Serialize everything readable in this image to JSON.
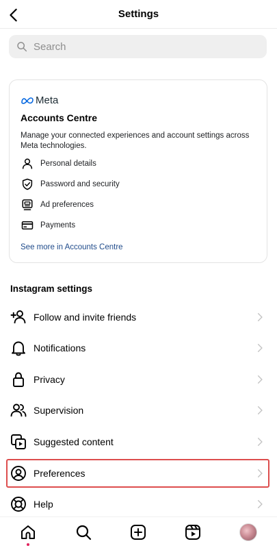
{
  "header": {
    "title": "Settings",
    "back_icon": "chevron-left-icon"
  },
  "search": {
    "placeholder": "Search",
    "value": ""
  },
  "accounts_centre": {
    "brand": "Meta",
    "title": "Accounts Centre",
    "description": "Manage your connected experiences and account settings across Meta technologies.",
    "items": [
      {
        "label": "Personal details",
        "icon": "person-icon"
      },
      {
        "label": "Password and security",
        "icon": "shield-check-icon"
      },
      {
        "label": "Ad preferences",
        "icon": "ad-monitor-icon"
      },
      {
        "label": "Payments",
        "icon": "credit-card-icon"
      }
    ],
    "link": "See more in Accounts Centre",
    "link_color": "#1e4a8a"
  },
  "instagram_settings": {
    "title": "Instagram settings",
    "items": [
      {
        "label": "Follow and invite friends",
        "icon": "add-person-icon"
      },
      {
        "label": "Notifications",
        "icon": "bell-icon"
      },
      {
        "label": "Privacy",
        "icon": "lock-icon"
      },
      {
        "label": "Supervision",
        "icon": "people-icon"
      },
      {
        "label": "Suggested content",
        "icon": "suggested-content-icon"
      },
      {
        "label": "Preferences",
        "icon": "account-circle-icon",
        "highlighted": true
      },
      {
        "label": "Help",
        "icon": "lifebuoy-icon"
      }
    ],
    "highlight_color": "#dd4d4d"
  },
  "bottom_nav": {
    "items": [
      {
        "name": "home",
        "icon": "home-icon",
        "active": true
      },
      {
        "name": "search",
        "icon": "search-icon"
      },
      {
        "name": "create",
        "icon": "plus-square-icon"
      },
      {
        "name": "reels",
        "icon": "reels-icon"
      },
      {
        "name": "profile",
        "icon": "avatar"
      }
    ],
    "notification_dot_color": "#e0245e"
  }
}
